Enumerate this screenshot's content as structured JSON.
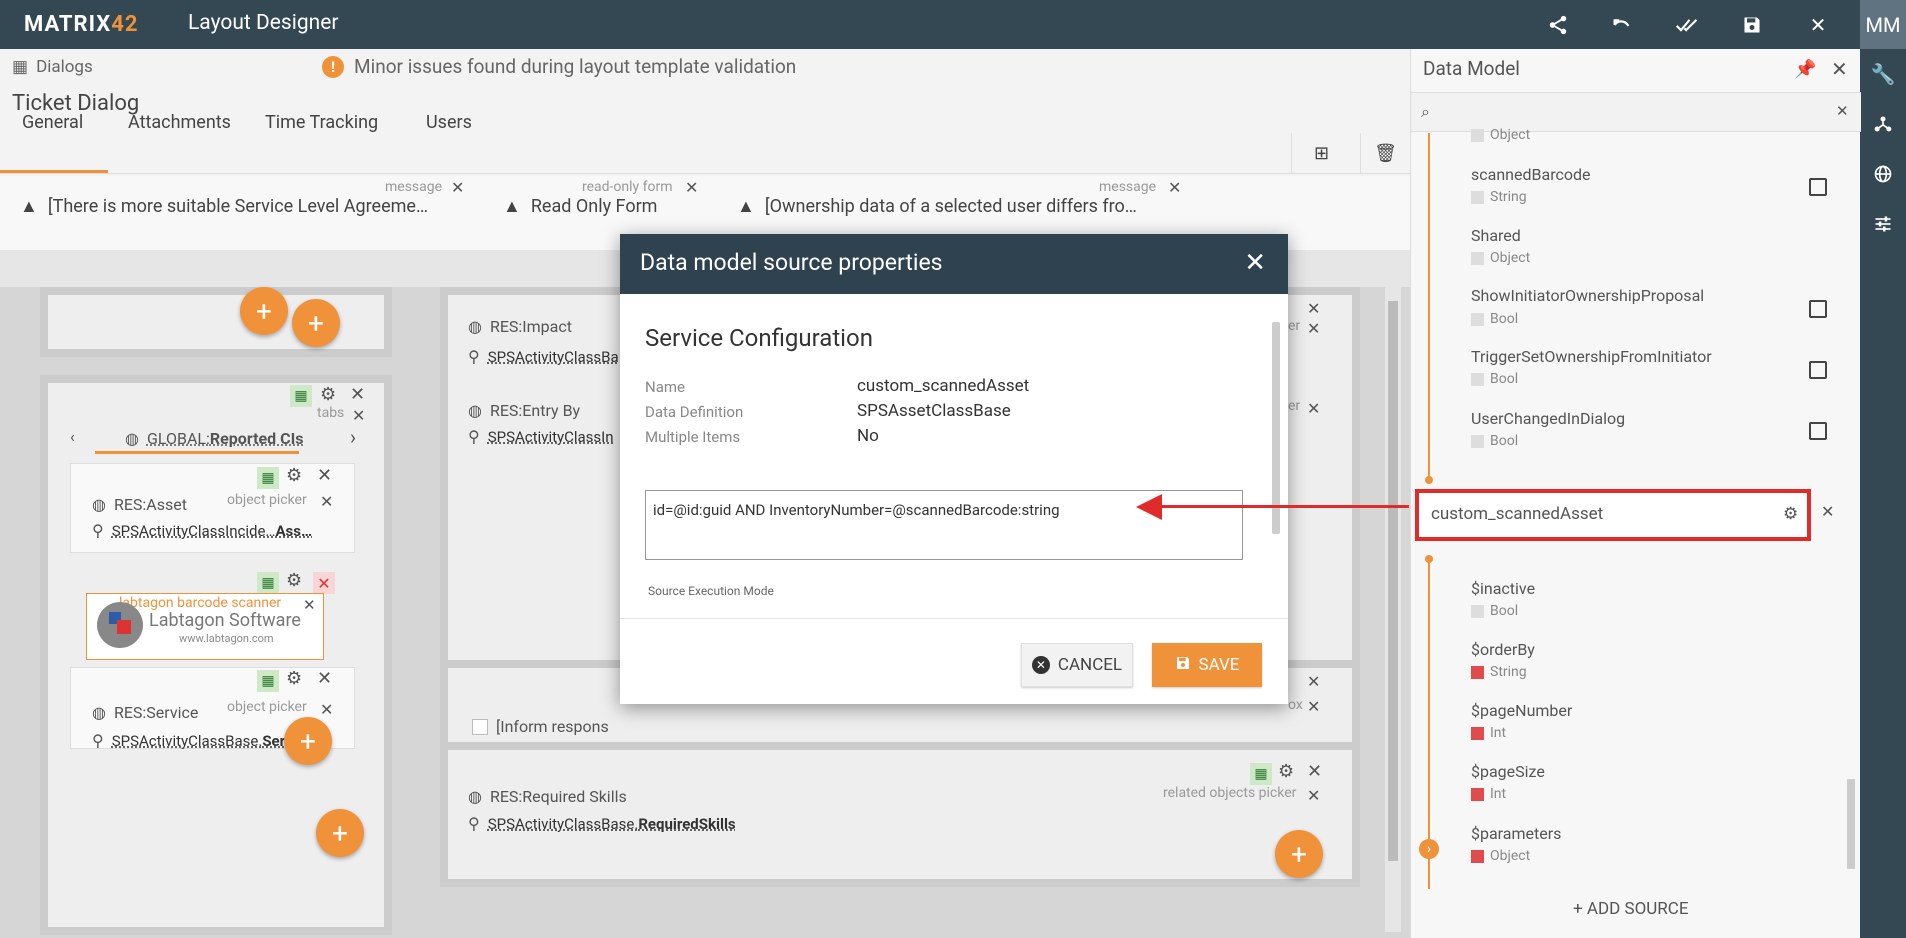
{
  "app": {
    "logo_text_a": "MATRIX",
    "logo_text_b": "42",
    "title": "Layout Designer",
    "user_initials": "MM"
  },
  "breadcrumb": {
    "label": "Dialogs"
  },
  "validation": {
    "message": "Minor issues found during layout template validation"
  },
  "dialog": {
    "title": "Ticket Dialog"
  },
  "tabs": [
    {
      "label": "General"
    },
    {
      "label": "Attachments"
    },
    {
      "label": "Time Tracking"
    },
    {
      "label": "Users"
    }
  ],
  "messages": [
    {
      "tag": "message",
      "text": "[There is more suitable Service Level Agreeme…"
    },
    {
      "tag": "read-only form",
      "text": "Read Only Form"
    },
    {
      "tag": "message",
      "text": "[Ownership data of a selected user differs fro…"
    }
  ],
  "canvas": {
    "tabs_tag": "tabs",
    "global_reported": "GLOBAL:",
    "global_reported_bold": "Reported CIs",
    "asset_res": "RES:Asset",
    "asset_tag": "object picker",
    "asset_cls": "SPSActivityClassIncide…",
    "asset_cls_bold": "Ass…",
    "barcode_label": "labtagon barcode scanner",
    "labtagon_text": "Labtagon Software",
    "labtagon_url": "www.labtagon.com",
    "service_res": "RES:Service",
    "service_tag": "object picker",
    "service_cls": "SPSActivityClassBase.",
    "service_cls_bold": "Ser",
    "impact_res": "RES:Impact",
    "impact_cls": "SPSActivityClassBa",
    "entry_res": "RES:Entry By",
    "entry_cls": "SPSActivityClassIn",
    "inform_text": "[Inform respons",
    "skills_res": "RES:Required Skills",
    "skills_tag": "related objects picker",
    "skills_cls": "SPSActivityClassBase.",
    "skills_cls_bold": "RequiredSkills",
    "tag_er": "er",
    "tag_ox": "ox"
  },
  "modal": {
    "title": "Data model source properties",
    "section": "Service Configuration",
    "fields": [
      {
        "label": "Name",
        "value": "custom_scannedAsset"
      },
      {
        "label": "Data Definition",
        "value": "SPSAssetClassBase"
      },
      {
        "label": "Multiple Items",
        "value": "No"
      }
    ],
    "query": "id=@id:guid AND InventoryNumber=@scannedBarcode:string",
    "mode_label": "Source Execution Mode",
    "cancel_label": "CANCEL",
    "save_label": "SAVE"
  },
  "data_model": {
    "title": "Data Model",
    "top_items": [
      {
        "name": "",
        "type": "Object"
      },
      {
        "name": "scannedBarcode",
        "type": "String"
      },
      {
        "name": "Shared",
        "type": "Object"
      },
      {
        "name": "ShowInitiatorOwnershipProposal",
        "type": "Bool"
      },
      {
        "name": "TriggerSetOwnershipFromInitiator",
        "type": "Bool"
      },
      {
        "name": "UserChangedInDialog",
        "type": "Bool"
      }
    ],
    "source_name": "custom_scannedAsset",
    "bottom_items": [
      {
        "name": "$inactive",
        "type": "Bool"
      },
      {
        "name": "$orderBy",
        "type": "String"
      },
      {
        "name": "$pageNumber",
        "type": "Int"
      },
      {
        "name": "$pageSize",
        "type": "Int"
      },
      {
        "name": "$parameters",
        "type": "Object"
      }
    ],
    "add_source_label": "+ ADD SOURCE"
  },
  "colors": {
    "accent": "#f0923a",
    "header": "#344854",
    "highlight": "#e02b2b"
  }
}
